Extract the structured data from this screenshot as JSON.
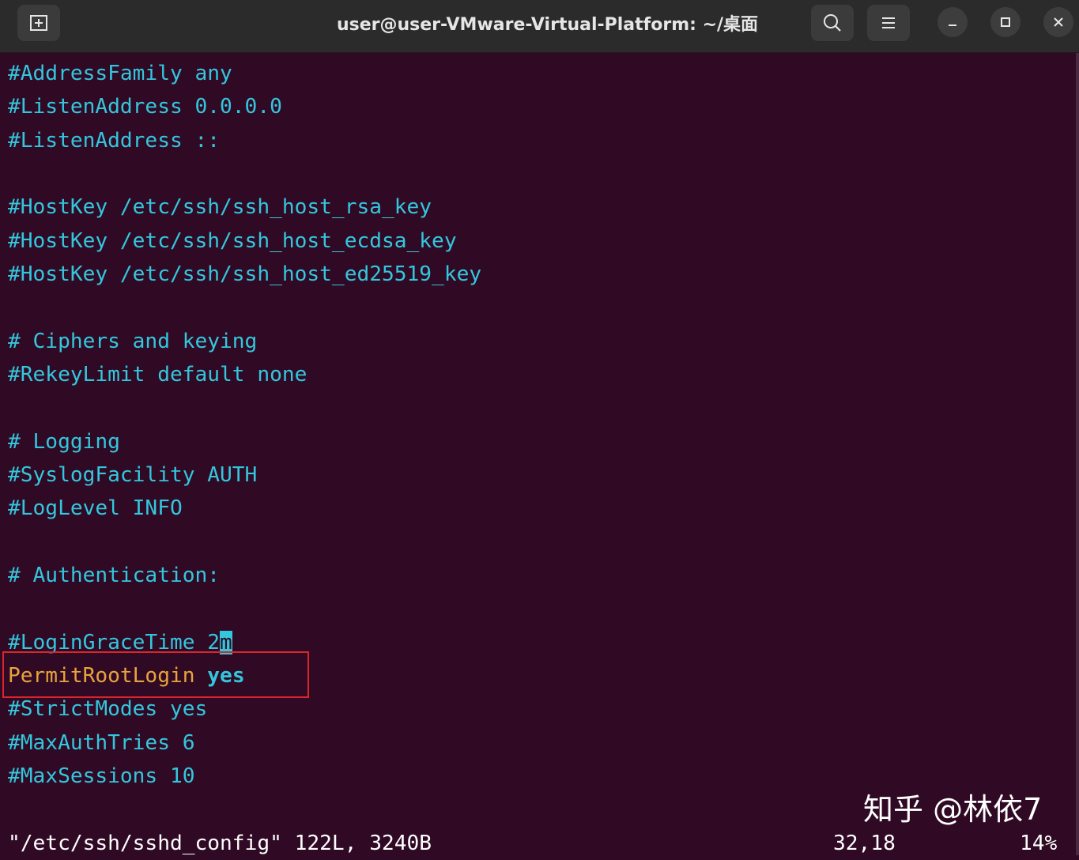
{
  "window": {
    "title": "user@user-VMware-Virtual-Platform: ~/桌面",
    "icons": [
      "new-tab-icon",
      "search-icon",
      "menu-icon",
      "minimize-icon",
      "maximize-icon",
      "close-icon"
    ]
  },
  "colors": {
    "background": "#300a24",
    "comment": "#33c7de",
    "keyword": "#e8a33d",
    "highlight_box": "#d9262b"
  },
  "lines": [
    "#AddressFamily any",
    "#ListenAddress 0.0.0.0",
    "#ListenAddress ::",
    "",
    "#HostKey /etc/ssh/ssh_host_rsa_key",
    "#HostKey /etc/ssh/ssh_host_ecdsa_key",
    "#HostKey /etc/ssh/ssh_host_ed25519_key",
    "",
    "# Ciphers and keying",
    "#RekeyLimit default none",
    "",
    "# Logging",
    "#SyslogFacility AUTH",
    "#LogLevel INFO",
    "",
    "# Authentication:",
    "",
    "#LoginGraceTime 2"
  ],
  "cursor_char": "m",
  "permit_line": {
    "key": "PermitRootLogin",
    "value": "yes"
  },
  "after_lines": [
    "#StrictModes yes",
    "#MaxAuthTries 6",
    "#MaxSessions 10"
  ],
  "status": {
    "file": "\"/etc/ssh/sshd_config\" 122L, 3240B",
    "position": "32,18",
    "percent": "14%"
  },
  "watermark": "知乎 @林依7"
}
